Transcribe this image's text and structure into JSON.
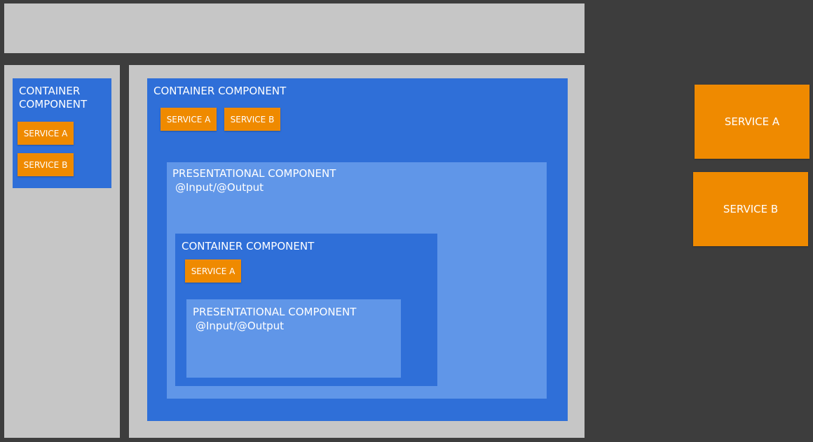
{
  "colors": {
    "background": "#3d3d3d",
    "panel": "#c6c6c6",
    "container": "#2f6fd8",
    "presentational": "#6096e8",
    "service": "#ef8a00",
    "text": "#ffffff"
  },
  "sidebar": {
    "container_label": "CONTAINER COMPONENT",
    "services": [
      "SERVICE A",
      "SERVICE B"
    ]
  },
  "main": {
    "container_label": "CONTAINER COMPONENT",
    "services": [
      "SERVICE A",
      "SERVICE B"
    ],
    "presentational": {
      "label": "PRESENTATIONAL COMPONENT",
      "io": "@Input/@Output",
      "inner_container": {
        "label": "CONTAINER COMPONENT",
        "services": [
          "SERVICE A"
        ],
        "presentational": {
          "label": "PRESENTATIONAL COMPONENT",
          "io": "@Input/@Output"
        }
      }
    }
  },
  "global_services": [
    "SERVICE A",
    "SERVICE B"
  ]
}
